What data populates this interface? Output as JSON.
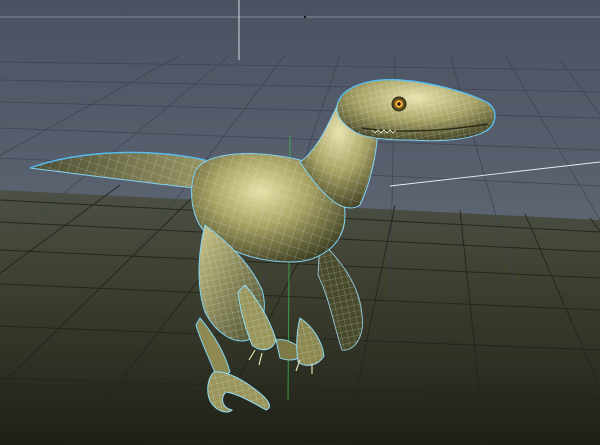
{
  "viewport": {
    "mode": "perspective",
    "shading": "smooth-shaded-with-wireframe-on-shaded",
    "background_color": "#5b6473",
    "floor_color": "#3a3c2c",
    "grid_line_color": "#2a2d30",
    "wire_color": "#b9f2ff",
    "model_base_color": "#8a8a4f",
    "model_highlight_color": "#e7e0a6",
    "selected_edge_color": "#4fbdf5"
  },
  "model": {
    "name_icon": "raptor-mesh-icon",
    "selected": true
  },
  "manipulators": {
    "vertical_guide_icon": "view-axis-guide-icon",
    "pivot_icon": "pivot-dot-icon"
  }
}
